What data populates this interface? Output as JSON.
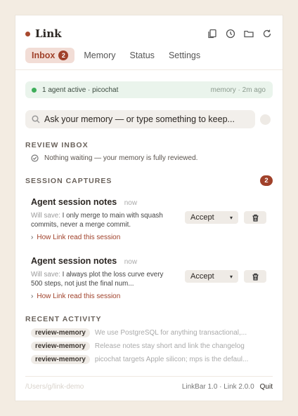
{
  "header": {
    "title": "Link"
  },
  "tabs": [
    {
      "label": "Inbox",
      "badge": "2"
    },
    {
      "label": "Memory"
    },
    {
      "label": "Status"
    },
    {
      "label": "Settings"
    }
  ],
  "status": {
    "text": "1 agent active · picochat",
    "right": "memory · 2m ago"
  },
  "search": {
    "text": "Ask your memory — or type something to keep..."
  },
  "review_inbox": {
    "heading": "REVIEW INBOX",
    "empty_text": "Nothing waiting — your memory is fully reviewed."
  },
  "session_captures": {
    "heading": "SESSION CAPTURES",
    "count": "2",
    "items": [
      {
        "title": "Agent session notes",
        "time": "now",
        "will_save_label": "Will save:",
        "body": "I only merge to main with squash commits, never a merge commit.",
        "link": "How Link read this session",
        "accept": "Accept"
      },
      {
        "title": "Agent session notes",
        "time": "now",
        "will_save_label": "Will save:",
        "body": "I always plot the loss curve every 500 steps, not just the final num...",
        "link": "How Link read this session",
        "accept": "Accept"
      }
    ]
  },
  "recent_activity": {
    "heading": "RECENT ACTIVITY",
    "items": [
      {
        "tag": "review-memory",
        "text": "We use PostgreSQL for anything transactional,..."
      },
      {
        "tag": "review-memory",
        "text": "Release notes stay short and link the changelog"
      },
      {
        "tag": "review-memory",
        "text": "picochat targets Apple silicon; mps is the defaul..."
      }
    ]
  },
  "footer": {
    "path": "/Users/g/link-demo",
    "version": "LinkBar 1.0 · Link 2.0.0",
    "quit": "Quit"
  },
  "colors": {
    "accent": "#a0412a",
    "status_green": "#3fae5a",
    "background": "#f3ece2"
  }
}
